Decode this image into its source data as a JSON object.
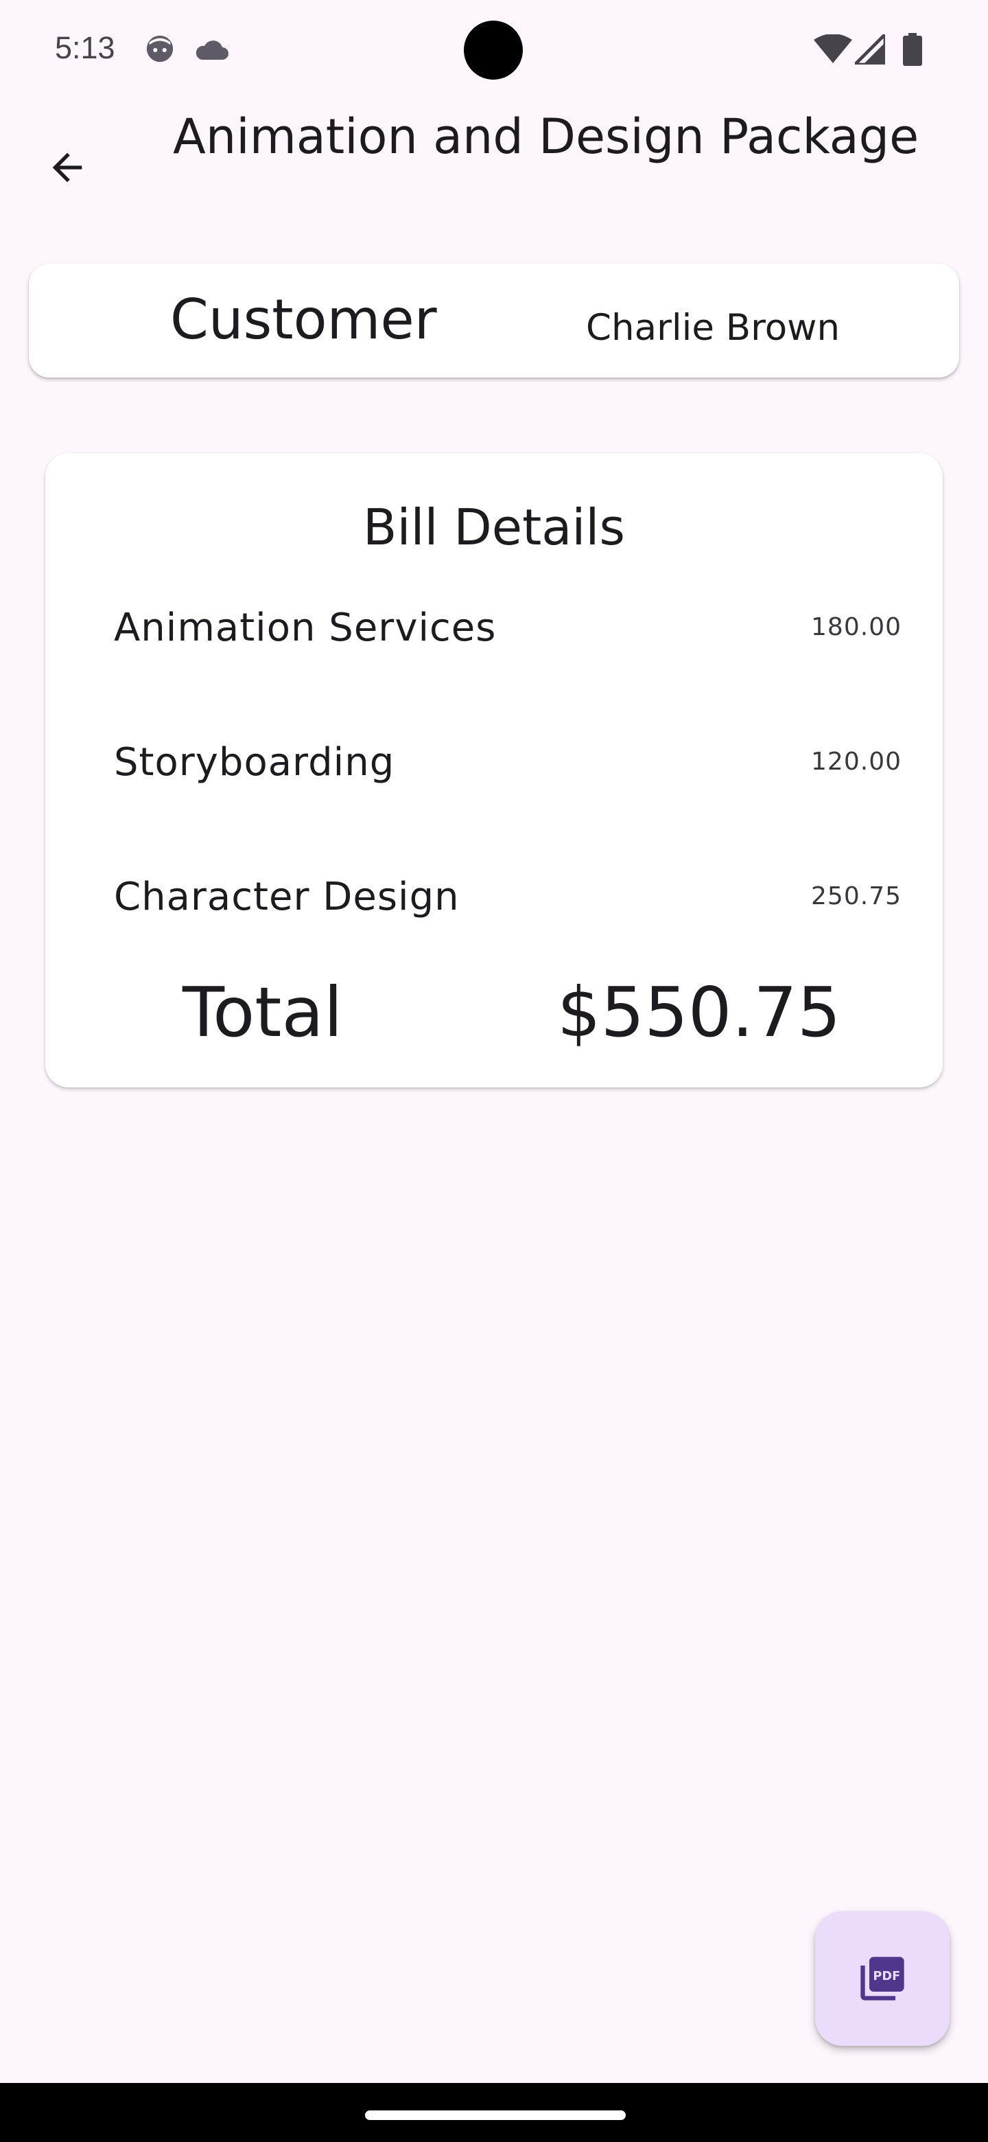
{
  "status_bar": {
    "time": "5:13",
    "icons": [
      "face-icon",
      "cloud-icon",
      "wifi-icon",
      "signal-icon",
      "battery-icon"
    ]
  },
  "app_bar": {
    "title": "Animation and Design Package",
    "back_icon": "arrow-back-icon"
  },
  "customer": {
    "label": "Customer",
    "name": "Charlie Brown"
  },
  "bill": {
    "title": "Bill Details",
    "items": [
      {
        "name": "Animation Services",
        "amount": "180.00"
      },
      {
        "name": "Storyboarding",
        "amount": "120.00"
      },
      {
        "name": "Character Design",
        "amount": "250.75"
      }
    ],
    "total_label": "Total",
    "total_value": "$550.75"
  },
  "fab": {
    "icon": "picture-as-pdf-icon",
    "icon_text": "PDF",
    "color": "#ebdcfb",
    "icon_color": "#4f378b"
  },
  "colors": {
    "background": "#fdf7fd",
    "card": "#ffffff",
    "text": "#1d1b20"
  }
}
